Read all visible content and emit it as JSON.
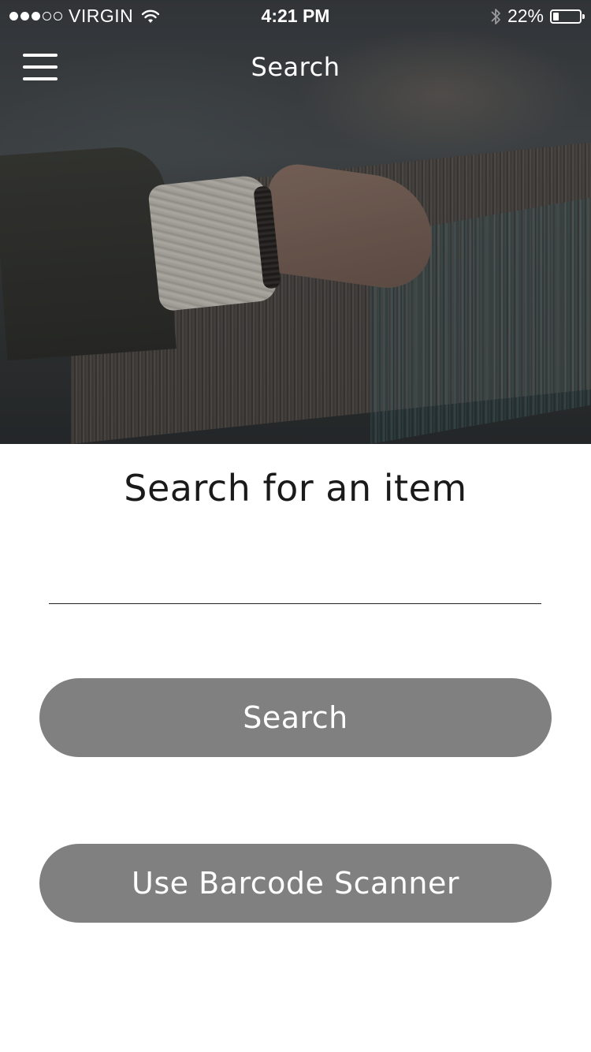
{
  "status_bar": {
    "signal_filled": 3,
    "signal_total": 5,
    "carrier": "VIRGIN",
    "time": "4:21 PM",
    "battery_percent_label": "22%",
    "battery_level": 0.22
  },
  "nav": {
    "title": "Search",
    "menu_icon": "hamburger-menu-icon"
  },
  "main": {
    "heading": "Search for an item",
    "search_input": {
      "value": "",
      "placeholder": ""
    },
    "search_button_label": "Search",
    "barcode_button_label": "Use Barcode Scanner"
  },
  "colors": {
    "button_background": "#808080",
    "button_text": "#ffffff",
    "heading_text": "#1a1a1a",
    "input_underline": "#222222"
  }
}
